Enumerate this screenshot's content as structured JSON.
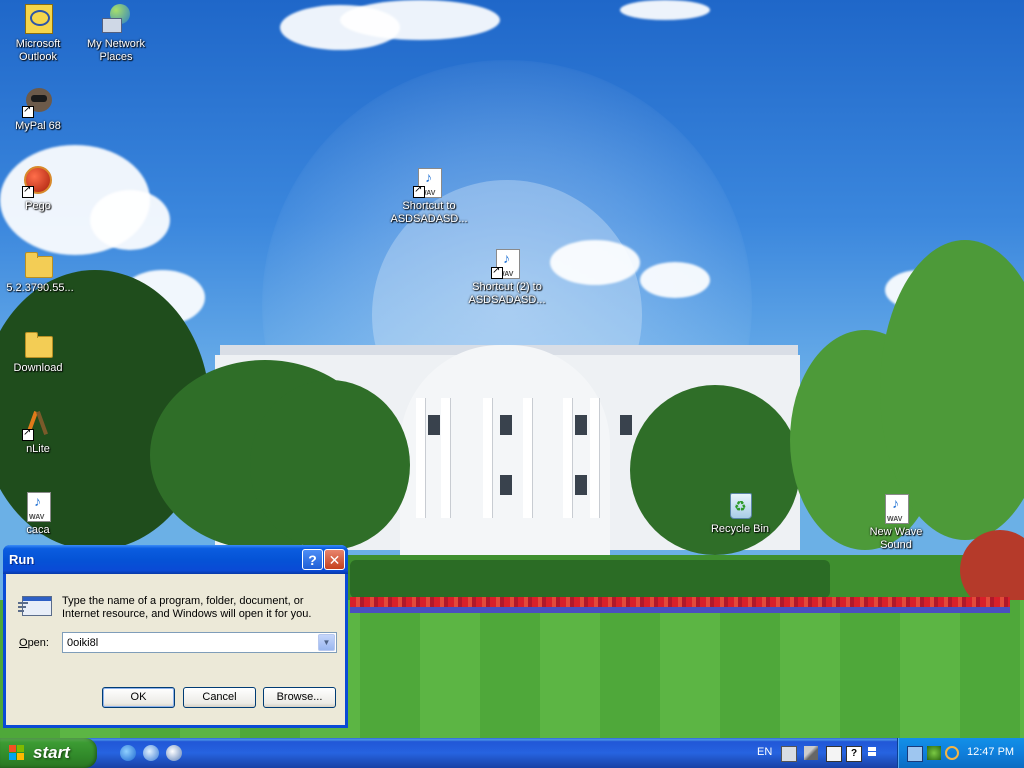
{
  "desktop": {
    "icons": [
      {
        "label": "Microsoft Outlook",
        "icon": "outlook-icon"
      },
      {
        "label": "My Network Places",
        "icon": "network-places-icon"
      },
      {
        "label": "MyPal 68",
        "icon": "mypal-icon"
      },
      {
        "label": "Pego",
        "icon": "pego-icon"
      },
      {
        "label": "5.2.3790.55...",
        "icon": "folder-icon"
      },
      {
        "label": "Download",
        "icon": "folder-icon"
      },
      {
        "label": "nLite",
        "icon": "nlite-icon"
      },
      {
        "label": "caca",
        "icon": "wav-file-icon"
      },
      {
        "label": "Shortcut to ASDSADASD...",
        "icon": "wav-shortcut-icon"
      },
      {
        "label": "Shortcut (2) to ASDSADASD...",
        "icon": "wav-shortcut-icon"
      },
      {
        "label": "Recycle Bin",
        "icon": "recycle-bin-icon"
      },
      {
        "label": "New Wave Sound",
        "icon": "wav-file-icon"
      }
    ]
  },
  "run_dialog": {
    "title": "Run",
    "description": "Type the name of a program, folder, document, or Internet resource, and Windows will open it for you.",
    "open_label_prefix": "",
    "open_label_accel": "O",
    "open_label_rest": "pen:",
    "open_value": "0oiki8l",
    "buttons": {
      "ok": "OK",
      "cancel": "Cancel",
      "browse": "Browse..."
    }
  },
  "taskbar": {
    "start_label": "start",
    "quick_launch": [
      "internet-explorer-icon",
      "outlook-express-icon",
      "media-player-icon"
    ],
    "language": "EN",
    "tray_icons": [
      "keyboard-icon",
      "tools-icon",
      "help-icon",
      "network-icon",
      "safely-remove-icon",
      "network-connection-icon",
      "search-icon"
    ],
    "clock": "12:47 PM"
  }
}
